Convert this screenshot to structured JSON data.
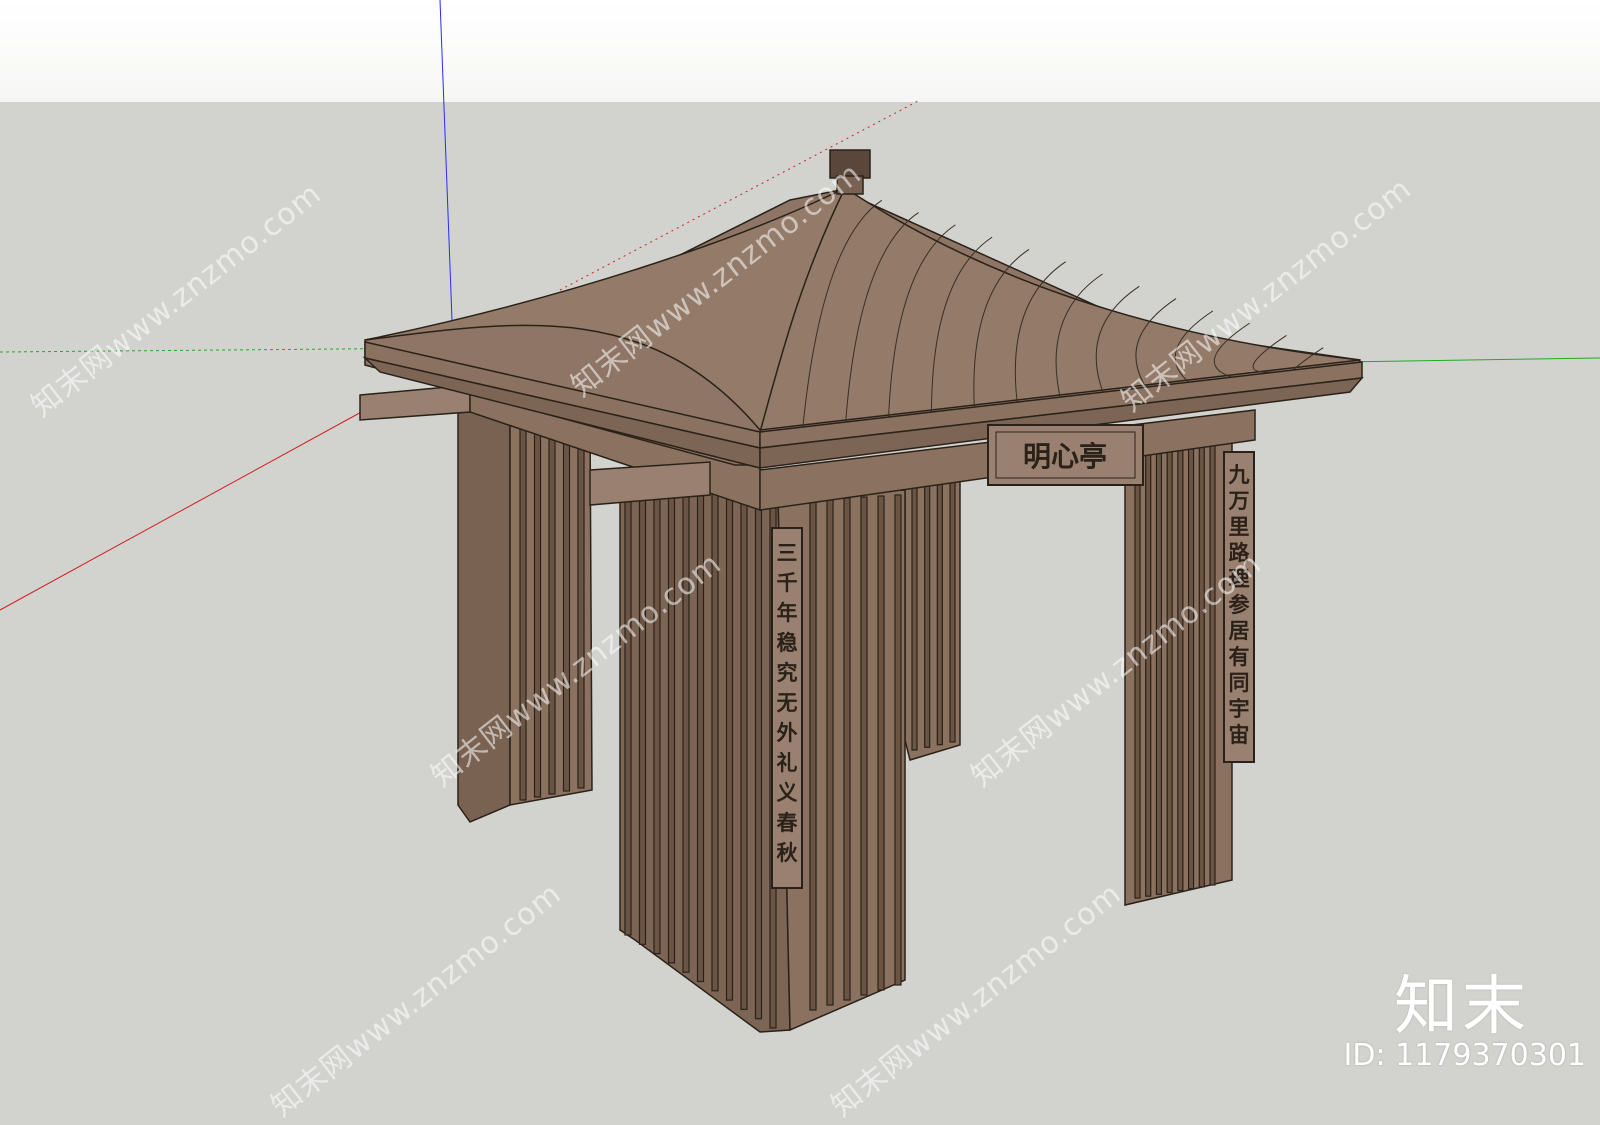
{
  "scene": {
    "sky_color": "#ffffff",
    "ground_color": "#d2d3cf",
    "wood_color": "#8a7160",
    "axis_colors": {
      "blue": "#2a2aff",
      "green": "#22aa22",
      "red": "#d02020"
    }
  },
  "pavilion": {
    "name_plaque": "明心亭",
    "couplet_left": [
      "三",
      "千",
      "年",
      "稳",
      "究",
      "无",
      "外",
      "礼",
      "义",
      "春",
      "秋"
    ],
    "couplet_right": [
      "九",
      "万",
      "里",
      "路",
      "理",
      "参",
      "居",
      "有",
      "同",
      "宇",
      "宙"
    ]
  },
  "watermark": {
    "text": "知末网www.znzmo.com",
    "brand": "知末",
    "id_label": "ID: 1179370301"
  }
}
